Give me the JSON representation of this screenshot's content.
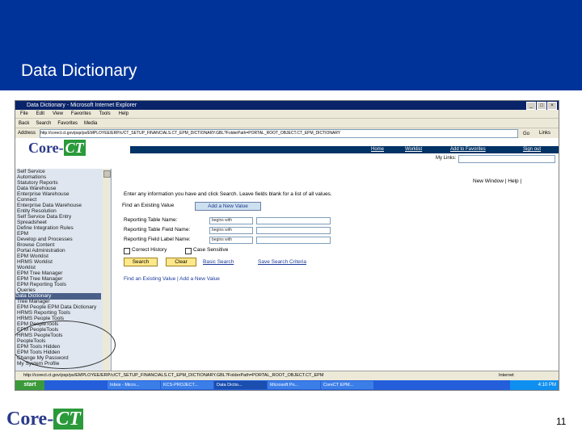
{
  "slide": {
    "title": "Data Dictionary",
    "page_number": "11",
    "logo_text_a": "Core-",
    "logo_text_b": "CT"
  },
  "browser": {
    "window_title": "Data Dictionary - Microsoft Internet Explorer",
    "menu": [
      "File",
      "Edit",
      "View",
      "Favorites",
      "Tools",
      "Help"
    ],
    "toolbar": [
      "Back",
      "Search",
      "Favorites",
      "Media"
    ],
    "address_label": "Address",
    "address": "http://corect.ct.gov/psp/ps/EMPLOYEE/ERP/c/CT_SETUP_FINANCIALS.CT_EPM_DICTIONARY.GBL?FolderPath=PORTAL_ROOT_OBJECT.CT_EPM_DICTIONARY",
    "go_label": "Go",
    "links_label": "Links",
    "status_url": "http://corect.ct.gov/psp/ps/EMPLOYEE/ERP/c/CT_SETUP_FINANCIALS.CT_EPM_DICTIONARY.GBL?FolderPath=PORTAL_ROOT_OBJECT.CT_EPM",
    "status_zone": "Internet"
  },
  "app": {
    "logo_a": "Core-",
    "logo_b": "CT",
    "nav_links": [
      "Home",
      "Worklist",
      "Add to Favorites",
      "Sign out"
    ],
    "my_links_label": "My Links:",
    "top_links": "New Window | Help |"
  },
  "menu": [
    "Self Service",
    "Automations",
    "Statutory Reports",
    "Data Warehouse",
    "Enterprise Warehouse",
    "Connect",
    "Enterprise Data Warehouse",
    "Entity Resolution",
    "Self Service Data Entry",
    "Spreadsheet",
    "Define Integration Rules",
    "EPM",
    "Develop and Processes",
    "Browse Content",
    "Portal Administration",
    "EPM Worklist",
    "HRMS Worklist",
    "Worklist",
    "EPM Tree Manager",
    "EPM Tree Manager",
    "EPM Reporting Tools",
    "Queries",
    "Data Dictionary",
    "Tree Manager",
    "EPM People EPM Data Dictionary",
    "HRMS Reporting Tools",
    "HRMS People Tools",
    "EPM PeopleTools",
    "EPM PeopleTools",
    "HRMS PeopleTools",
    "PeopleTools",
    "EPM Tools Hidden",
    "EPM Tools Hidden",
    "Change My Password",
    "My System Profile"
  ],
  "form": {
    "instructions": "Enter any information you have and click Search. Leave fields blank for a list of all values.",
    "tab_find": "Find an Existing Value",
    "tab_add": "Add a New Value",
    "fields": [
      {
        "label": "Reporting Table Name:",
        "op": "begins with"
      },
      {
        "label": "Reporting Table Field Name:",
        "op": "begins with"
      },
      {
        "label": "Reporting Field Label Name:",
        "op": "begins with"
      }
    ],
    "correct_history": "Correct History",
    "case_sensitive": "Case Sensitive",
    "search_btn": "Search",
    "clear_btn": "Clear",
    "basic_search": "Basic Search",
    "save_criteria": "Save Search Criteria",
    "find_links": "Find an Existing Value | Add a New Value"
  },
  "taskbar": {
    "start": "start",
    "tasks": [
      "Inbox - Micro...",
      "KCS-PROJECT...",
      "Data Dictio...",
      "Microsoft Po...",
      "CoreCT EPM..."
    ],
    "clock": "4:10 PM"
  }
}
